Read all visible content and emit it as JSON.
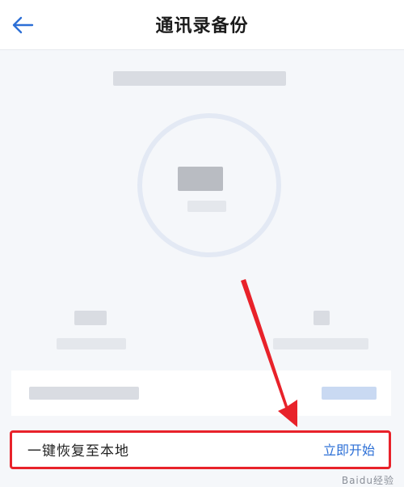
{
  "header": {
    "title": "通讯录备份",
    "back_icon": "arrow-left-icon"
  },
  "restore": {
    "label": "一键恢复至本地",
    "action": "立即开始"
  },
  "annotation": {
    "highlight_color": "#e8222a"
  },
  "watermark": "Baidu经验",
  "colors": {
    "accent": "#2c6fd6",
    "back_icon": "#2c6fd6"
  }
}
